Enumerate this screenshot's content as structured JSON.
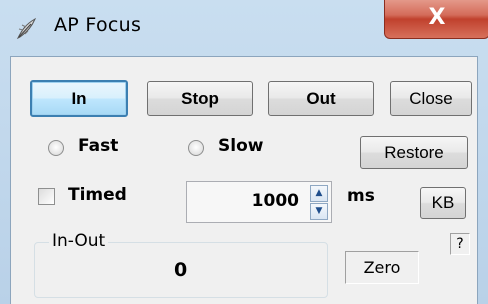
{
  "window": {
    "title": "AP  Focus",
    "close_glyph": "X",
    "icon": "app-feather-icon"
  },
  "buttons": {
    "in": "In",
    "stop": "Stop",
    "out": "Out",
    "close": "Close",
    "restore": "Restore",
    "kb": "KB"
  },
  "speed": {
    "fast": "Fast",
    "slow": "Slow"
  },
  "timed": {
    "label": "Timed",
    "value": "1000",
    "unit": "ms"
  },
  "in_out": {
    "label": "In-Out",
    "value": "0",
    "zero": "Zero",
    "help": "?"
  },
  "colors": {
    "default_button_border": "#3c7fb1",
    "title_close": "#c0412d"
  }
}
